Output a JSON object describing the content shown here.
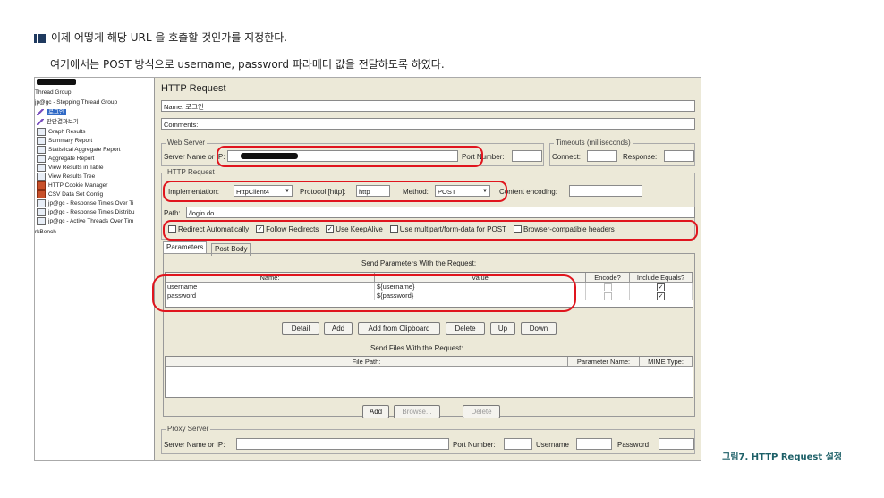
{
  "intro": {
    "line1": "이제 어떻게 해당 URL 을 호출할 것인가를 지정한다.",
    "line2": "여기에서는 POST 방식으로 username, password 파라메터 값을 전달하도록 하였다."
  },
  "caption": "그림7. HTTP Request 설정",
  "tree": {
    "items": [
      {
        "label": "Thread Group",
        "icon": "",
        "selected": false
      },
      {
        "label": "jp@gc - Stepping Thread Group",
        "icon": "",
        "selected": false
      },
      {
        "label": "로그인",
        "icon": "pencil-icon",
        "selected": true
      },
      {
        "label": "잔단결과보기",
        "icon": "pencil-icon",
        "selected": false
      },
      {
        "label": "Graph Results",
        "icon": "report-icon",
        "selected": false
      },
      {
        "label": "Summary Report",
        "icon": "report-icon",
        "selected": false
      },
      {
        "label": "Statistical Aggregate Report",
        "icon": "report-icon",
        "selected": false
      },
      {
        "label": "Aggregate Report",
        "icon": "report-icon",
        "selected": false
      },
      {
        "label": "View Results in Table",
        "icon": "report-icon",
        "selected": false
      },
      {
        "label": "View Results Tree",
        "icon": "report-icon",
        "selected": false
      },
      {
        "label": "HTTP Cookie Manager",
        "icon": "config-icon",
        "selected": false
      },
      {
        "label": "CSV Data Set Config",
        "icon": "config-icon",
        "selected": false
      },
      {
        "label": "jp@gc - Response Times Over Ti",
        "icon": "report-icon",
        "selected": false
      },
      {
        "label": "jp@gc - Response Times Distribu",
        "icon": "report-icon",
        "selected": false
      },
      {
        "label": "jp@gc - Active Threads Over Tim",
        "icon": "report-icon",
        "selected": false
      },
      {
        "label": "rkBench",
        "icon": "",
        "selected": false
      }
    ]
  },
  "panel": {
    "title": "HTTP Request",
    "name_label": "Name:",
    "name_value": "로그인",
    "comments_label": "Comments:",
    "web_server": {
      "group_title": "Web Server",
      "server_label": "Server Name or IP:",
      "port_label": "Port Number:",
      "timeouts_title": "Timeouts (milliseconds)",
      "connect_label": "Connect:",
      "response_label": "Response:"
    },
    "http_request": {
      "group_title": "HTTP Request",
      "impl_label": "Implementation:",
      "impl_value": "HttpClient4",
      "protocol_label": "Protocol [http]:",
      "protocol_value": "http",
      "method_label": "Method:",
      "method_value": "POST",
      "encoding_label": "Content encoding:",
      "path_label": "Path:",
      "path_value": "/login.do"
    },
    "options": [
      {
        "label": "Redirect Automatically",
        "checked": false
      },
      {
        "label": "Follow Redirects",
        "checked": true
      },
      {
        "label": "Use KeepAlive",
        "checked": true
      },
      {
        "label": "Use multipart/form-data for POST",
        "checked": false
      },
      {
        "label": "Browser-compatible headers",
        "checked": false
      }
    ],
    "tabs": [
      "Parameters",
      "Post Body"
    ],
    "params": {
      "title": "Send Parameters With the Request:",
      "headers": [
        "Name:",
        "Value",
        "Encode?",
        "Include Equals?"
      ],
      "rows": [
        {
          "name": "username",
          "value": "${username}",
          "encode": false,
          "include": true
        },
        {
          "name": "password",
          "value": "${password}",
          "encode": false,
          "include": true
        }
      ],
      "buttons": [
        "Detail",
        "Add",
        "Add from Clipboard",
        "Delete",
        "Up",
        "Down"
      ]
    },
    "files": {
      "title": "Send Files With the Request:",
      "headers": [
        "File Path:",
        "Parameter Name:",
        "MIME Type:"
      ],
      "buttons": [
        "Add",
        "Browse...",
        "Delete"
      ]
    },
    "proxy": {
      "group_title": "Proxy Server",
      "server_label": "Server Name or IP:",
      "port_label": "Port Number:",
      "username_label": "Username",
      "password_label": "Password"
    },
    "check_mark": "✓",
    "dropdown_arrow": "▼"
  },
  "colors": {
    "annotation": "#e0151e",
    "caption": "#1c5f67",
    "bullet": "#1f3a5f",
    "selection": "#316ac5"
  }
}
